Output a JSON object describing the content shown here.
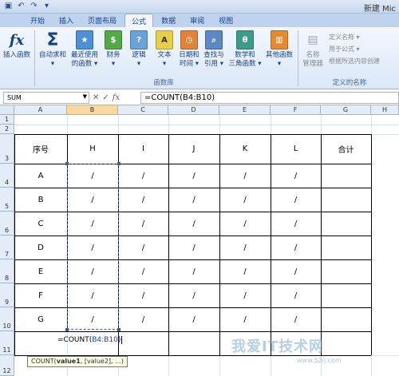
{
  "titlebar": {
    "title": "新建 Mic",
    "qat_icons": [
      "save-icon",
      "undo-icon",
      "redo-icon"
    ]
  },
  "tabs": [
    "开始",
    "插入",
    "页面布局",
    "公式",
    "数据",
    "审阅",
    "视图"
  ],
  "active_tab": "公式",
  "ribbon": {
    "insert_function": {
      "icon": "fx",
      "label": "插入函数"
    },
    "autosum": {
      "icon": "Σ",
      "line1": "自动求和",
      "line2": "▾"
    },
    "recent": {
      "line1": "最近使用",
      "line2": "的函数 ▾"
    },
    "financial": {
      "line1": "财务",
      "line2": "▾"
    },
    "logical": {
      "line1": "逻辑",
      "line2": "▾"
    },
    "text": {
      "line1": "文本",
      "line2": "▾"
    },
    "datetime": {
      "line1": "日期和",
      "line2": "时间 ▾"
    },
    "lookup": {
      "line1": "查找与",
      "line2": "引用 ▾"
    },
    "math": {
      "line1": "数学和",
      "line2": "三角函数 ▾"
    },
    "more": {
      "line1": "其他函数",
      "line2": "▾"
    },
    "group_function_library": "函数库",
    "name_manager": {
      "line1": "名称",
      "line2": "管理器"
    },
    "define_name": "定义名称 ▾",
    "use_in_formula": "用于公式 ▾",
    "create_from_selection": "根据所选内容创建",
    "group_defined_names": "定义的名称"
  },
  "formula_bar": {
    "name_box": "SUM",
    "fx": "fx",
    "formula": "=COUNT(B4:B10)"
  },
  "columns": [
    "A",
    "B",
    "C",
    "D",
    "E",
    "F",
    "G",
    "H"
  ],
  "rows": [
    "1",
    "2",
    "3",
    "4",
    "5",
    "6",
    "7",
    "8",
    "9",
    "10",
    "11",
    "12"
  ],
  "table": {
    "header": [
      "序号",
      "H",
      "I",
      "J",
      "K",
      "L",
      "合计"
    ],
    "row_labels": [
      "A",
      "B",
      "C",
      "D",
      "E",
      "F",
      "G"
    ],
    "slash": "/"
  },
  "edit_cell": {
    "prefix": "=COUNT(",
    "ref": "B4:B10",
    "suffix": ")"
  },
  "tooltip": {
    "fn": "COUNT(",
    "arg1": "value1",
    "rest": ", [value2], ...)"
  },
  "watermark": {
    "main": "我爱IT技术网",
    "sub": "www.52ij.com"
  },
  "colors": {
    "ribbon_text": "#15428b",
    "selected_col": "#f9d99f",
    "ref_blue": "#1a3fb0"
  }
}
